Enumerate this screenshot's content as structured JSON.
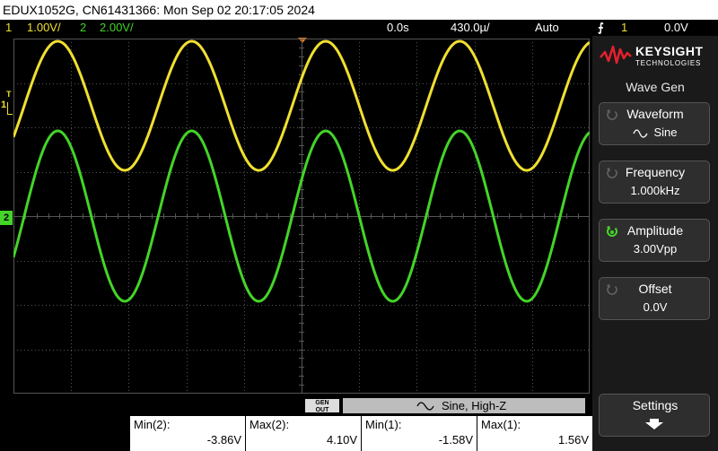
{
  "title_bar": {
    "text": "EDUX1052G, CN61431366: Mon Sep 02 20:17:05 2024"
  },
  "status": {
    "ch1_num": "1",
    "ch1_scale": "1.00V/",
    "ch2_num": "2",
    "ch2_scale": "2.00V/",
    "time_delay": "0.0s",
    "time_scale": "430.0µ/",
    "trigger_mode": "Auto",
    "trigger_source": "1",
    "trigger_level": "0.0V"
  },
  "colors": {
    "ch1": "#f0e030",
    "ch2": "#44d428",
    "grid": "#555555",
    "trigger": "#f08020"
  },
  "markers": {
    "ch1": "1",
    "ch2": "2",
    "trigger_tag": "T"
  },
  "brand": {
    "name": "KEYSIGHT",
    "sub": "TECHNOLOGIES"
  },
  "panel": {
    "title": "Wave Gen",
    "softkeys": [
      {
        "label": "Waveform",
        "value": "Sine",
        "icon": "rotate-knob-icon"
      },
      {
        "label": "Frequency",
        "value": "1.000kHz",
        "icon": "rotate-knob-icon"
      },
      {
        "label": "Amplitude",
        "value": "3.00Vpp",
        "icon": "active-knob-icon"
      },
      {
        "label": "Offset",
        "value": "0.0V",
        "icon": "rotate-knob-icon"
      }
    ],
    "settings": {
      "label": "Settings",
      "icon": "down-arrow-icon"
    }
  },
  "gen_bar": {
    "tag_line1": "GEN",
    "tag_line2": "OUT",
    "text": "Sine, High-Z"
  },
  "measurements": [
    {
      "label": "Min(2):",
      "value": "-3.86V"
    },
    {
      "label": "Max(2):",
      "value": "4.10V"
    },
    {
      "label": "Min(1):",
      "value": "-1.58V"
    },
    {
      "label": "Max(1):",
      "value": "1.56V"
    }
  ]
}
